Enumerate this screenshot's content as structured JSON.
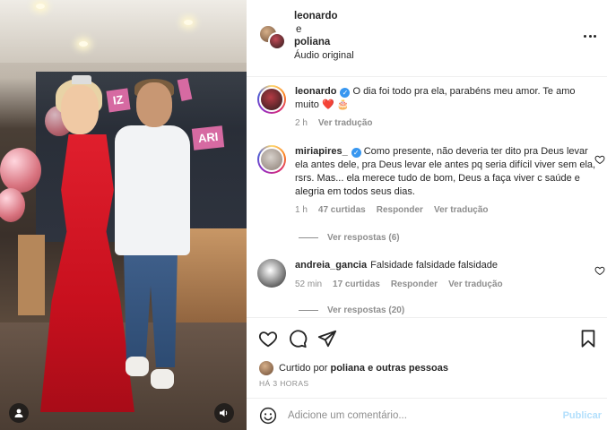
{
  "header": {
    "user1": "leonardo",
    "conjunction": "e",
    "user2": "poliana",
    "audio": "Áudio original",
    "more_icon": "more-horizontal-icon"
  },
  "media": {
    "banner_text_1": "IZ",
    "banner_text_2": "ARI",
    "user_tag_icon": "user-tag-icon",
    "audio_icon": "speaker-icon"
  },
  "comments": [
    {
      "username": "leonardo",
      "verified": true,
      "text": "O dia foi todo pra ela, parabéns meu amor. Te amo muito ❤️ 🎂",
      "time": "2 h",
      "translate": "Ver tradução"
    },
    {
      "username": "miriapires_",
      "verified": true,
      "text": "Como presente, não deveria ter dito pra Deus levar ela antes dele, pra Deus levar ele antes pq seria difícil viver sem ela, rsrs. Mas... ela merece tudo de bom, Deus a faça viver c saúde e alegria em todos seus dias.",
      "time": "1 h",
      "likes": "47 curtidas",
      "reply": "Responder",
      "translate": "Ver tradução",
      "replies": "Ver respostas (6)"
    },
    {
      "username": "andreia_gancia",
      "verified": false,
      "text": "Falsidade falsidade falsidade",
      "time": "52 min",
      "likes": "17 curtidas",
      "reply": "Responder",
      "translate": "Ver tradução",
      "replies": "Ver respostas (20)"
    }
  ],
  "actions": {
    "like_icon": "heart-icon",
    "comment_icon": "comment-icon",
    "share_icon": "send-icon",
    "save_icon": "bookmark-icon",
    "liked_prefix": "Curtido por",
    "liked_user": "poliana",
    "liked_suffix": "e outras pessoas",
    "time": "HÁ 3 HORAS"
  },
  "add_comment": {
    "emoji_icon": "emoji-icon",
    "placeholder": "Adicione um comentário...",
    "publish": "Publicar"
  },
  "colors": {
    "text": "#262626",
    "secondary": "#8e8e8e",
    "verified": "#3897f0",
    "publish_disabled": "#b2dffc"
  }
}
